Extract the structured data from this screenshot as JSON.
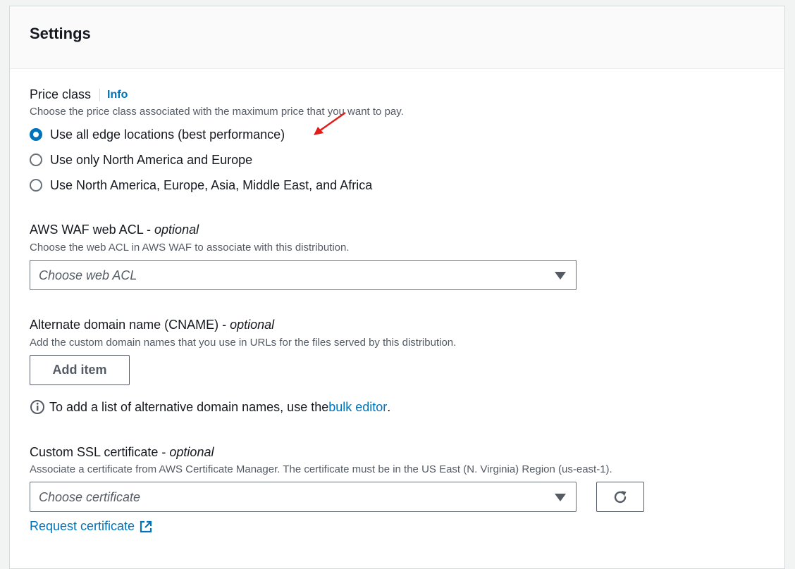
{
  "settings": {
    "title": "Settings",
    "price_class": {
      "label": "Price class",
      "info": "Info",
      "description": "Choose the price class associated with the maximum price that you want to pay.",
      "options": [
        {
          "label": "Use all edge locations (best performance)",
          "selected": true
        },
        {
          "label": "Use only North America and Europe",
          "selected": false
        },
        {
          "label": "Use North America, Europe, Asia, Middle East, and Africa",
          "selected": false
        }
      ]
    },
    "waf": {
      "label": "AWS WAF web ACL - ",
      "optional": "optional",
      "description": "Choose the web ACL in AWS WAF to associate with this distribution.",
      "placeholder": "Choose web ACL"
    },
    "cname": {
      "label": "Alternate domain name (CNAME) - ",
      "optional": "optional",
      "description": "Add the custom domain names that you use in URLs for the files served by this distribution.",
      "add_item": "Add item",
      "hint_prefix": "To add a list of alternative domain names, use the ",
      "hint_link": "bulk editor",
      "hint_suffix": "."
    },
    "ssl": {
      "label": "Custom SSL certificate - ",
      "optional": "optional",
      "description": "Associate a certificate from AWS Certificate Manager. The certificate must be in the US East (N. Virginia) Region (us-east-1).",
      "placeholder": "Choose certificate",
      "request_link": "Request certificate"
    }
  },
  "colors": {
    "accent": "#0073bb",
    "annotation_arrow": "#e21b1b"
  }
}
